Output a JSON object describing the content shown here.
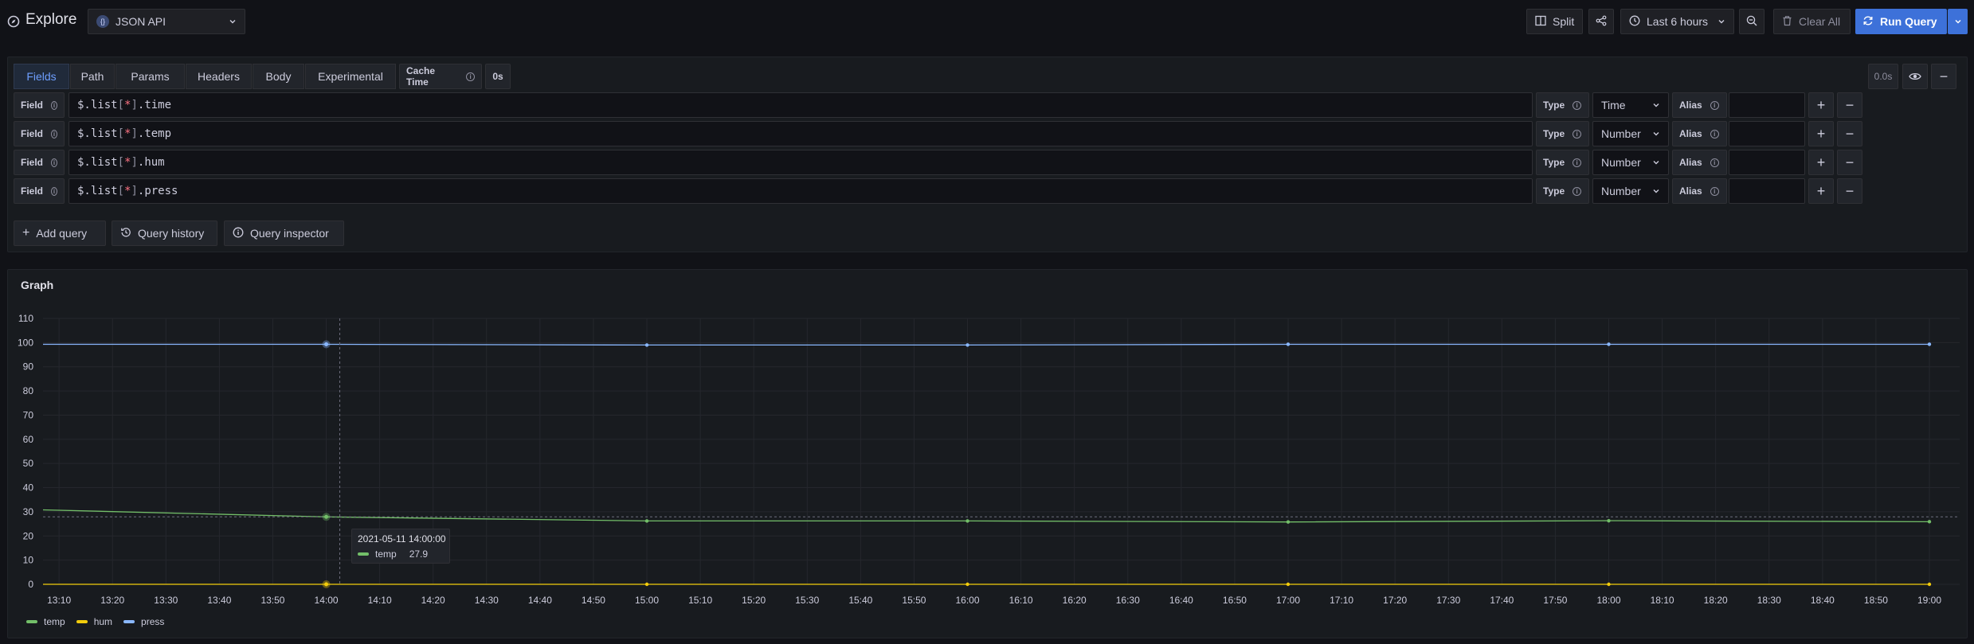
{
  "header": {
    "title": "Explore",
    "datasource": "JSON API",
    "split_label": "Split",
    "time_range": "Last 6 hours",
    "clear_label": "Clear All",
    "run_label": "Run Query"
  },
  "query": {
    "tabs": [
      "Fields",
      "Path",
      "Params",
      "Headers",
      "Body",
      "Experimental"
    ],
    "active_tab": "Fields",
    "cache_label": "Cache Time",
    "cache_value": "0s",
    "query_time": "0.0s",
    "field_label": "Field",
    "type_label": "Type",
    "alias_label": "Alias",
    "fields": [
      {
        "pre": "$.list",
        "lb": "[",
        "star": "*",
        "rb": "]",
        "post": ".time",
        "type": "Time",
        "alias": ""
      },
      {
        "pre": "$.list",
        "lb": "[",
        "star": "*",
        "rb": "]",
        "post": ".temp",
        "type": "Number",
        "alias": ""
      },
      {
        "pre": "$.list",
        "lb": "[",
        "star": "*",
        "rb": "]",
        "post": ".hum",
        "type": "Number",
        "alias": ""
      },
      {
        "pre": "$.list",
        "lb": "[",
        "star": "*",
        "rb": "]",
        "post": ".press",
        "type": "Number",
        "alias": ""
      }
    ],
    "actions": {
      "add": "Add query",
      "history": "Query history",
      "inspector": "Query inspector"
    }
  },
  "graph": {
    "title": "Graph"
  },
  "colors": {
    "temp": "#73bf69",
    "hum": "#f2cc0c",
    "press": "#8ab8ff",
    "accent": "#3d71d9"
  },
  "tooltip": {
    "time": "2021-05-11 14:00:00",
    "series": "temp",
    "value": "27.9"
  },
  "chart_data": {
    "type": "line",
    "title": "Graph",
    "xlabel": "",
    "ylabel": "",
    "ylim": [
      0,
      110
    ],
    "y_ticks": [
      "0",
      "10",
      "20",
      "30",
      "40",
      "50",
      "60",
      "70",
      "80",
      "90",
      "100",
      "110"
    ],
    "x_ticks": [
      "13:10",
      "13:20",
      "13:30",
      "13:40",
      "13:50",
      "14:00",
      "14:10",
      "14:20",
      "14:30",
      "14:40",
      "14:50",
      "15:00",
      "15:10",
      "15:20",
      "15:30",
      "15:40",
      "15:50",
      "16:00",
      "16:10",
      "16:20",
      "16:30",
      "16:40",
      "16:50",
      "17:00",
      "17:10",
      "17:20",
      "17:30",
      "17:40",
      "17:50",
      "18:00",
      "18:10",
      "18:20",
      "18:30",
      "18:40",
      "18:50",
      "19:00"
    ],
    "x_range": [
      "13:07",
      "19:00"
    ],
    "x": [
      "13:07",
      "14:00",
      "15:00",
      "16:00",
      "17:00",
      "18:00",
      "19:00"
    ],
    "series": [
      {
        "name": "temp",
        "values": [
          30.8,
          27.9,
          26.2,
          26.2,
          25.8,
          26.3,
          25.9
        ]
      },
      {
        "name": "hum",
        "values": [
          0,
          0,
          0,
          0,
          0,
          0,
          0
        ]
      },
      {
        "name": "press",
        "values": [
          99.3,
          99.3,
          99.0,
          99.0,
          99.3,
          99.3,
          99.3
        ]
      }
    ],
    "legend": "bottom-left",
    "grid": true
  }
}
